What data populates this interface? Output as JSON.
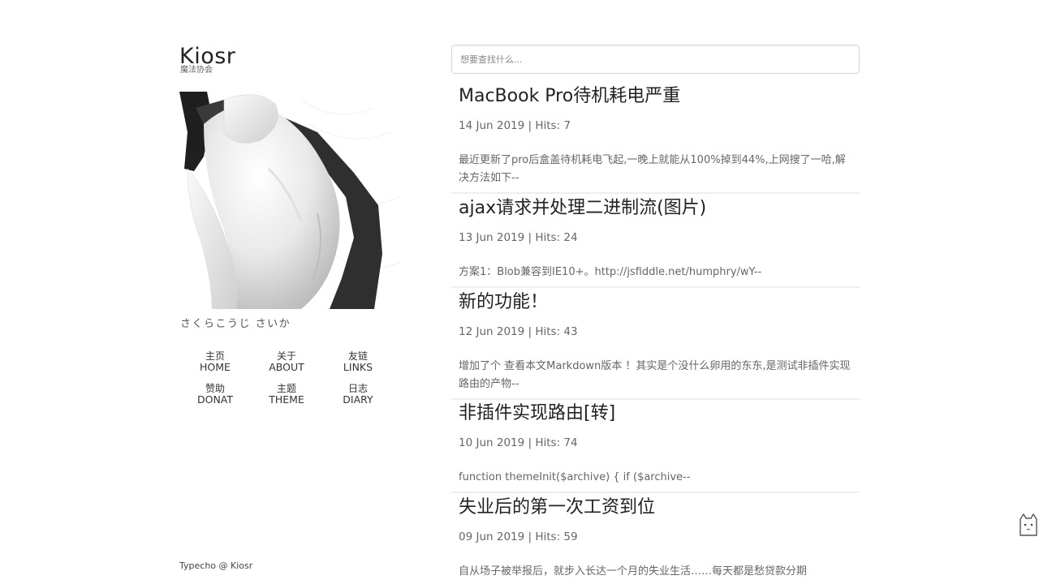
{
  "site": {
    "title": "Kiosr",
    "subtitle": "魔法协会"
  },
  "author": {
    "name": "さくらこうじ さいか"
  },
  "nav": [
    {
      "zh": "主页",
      "en": "HOME"
    },
    {
      "zh": "关于",
      "en": "ABOUT"
    },
    {
      "zh": "友链",
      "en": "LINKS"
    },
    {
      "zh": "赞助",
      "en": "DONAT"
    },
    {
      "zh": "主题",
      "en": "THEME"
    },
    {
      "zh": "日志",
      "en": "DIARY"
    }
  ],
  "footer": "Typecho @ Kiosr",
  "search": {
    "placeholder": "想要查找什么..."
  },
  "posts": [
    {
      "title": "MacBook Pro待机耗电严重",
      "meta": "14 Jun 2019 | Hits: 7",
      "excerpt": "最近更新了pro后盒盖待机耗电飞起,一晚上就能从100%掉到44%,上网搜了一哈,解决方法如下--"
    },
    {
      "title": "ajax请求并处理二进制流(图片)",
      "meta": "13 Jun 2019 | Hits: 24",
      "excerpt": "方案1：Blob兼容到IE10+。http://jsfiddle.net/humphry/wY--"
    },
    {
      "title": "新的功能！",
      "meta": "12 Jun 2019 | Hits: 43",
      "excerpt": "增加了个 查看本文Markdown版本 ！其实是个没什么卵用的东东,是测试非插件实现路由的产物--"
    },
    {
      "title": "非插件实现路由[转]",
      "meta": "10 Jun 2019 | Hits: 74",
      "excerpt": "function themeInit($archive) { if ($archive--"
    },
    {
      "title": "失业后的第一次工资到位",
      "meta": "09 Jun 2019 | Hits: 59",
      "excerpt": "自从场子被举报后，就步入长达一个月的失业生活……每天都是愁贷款分期"
    }
  ]
}
